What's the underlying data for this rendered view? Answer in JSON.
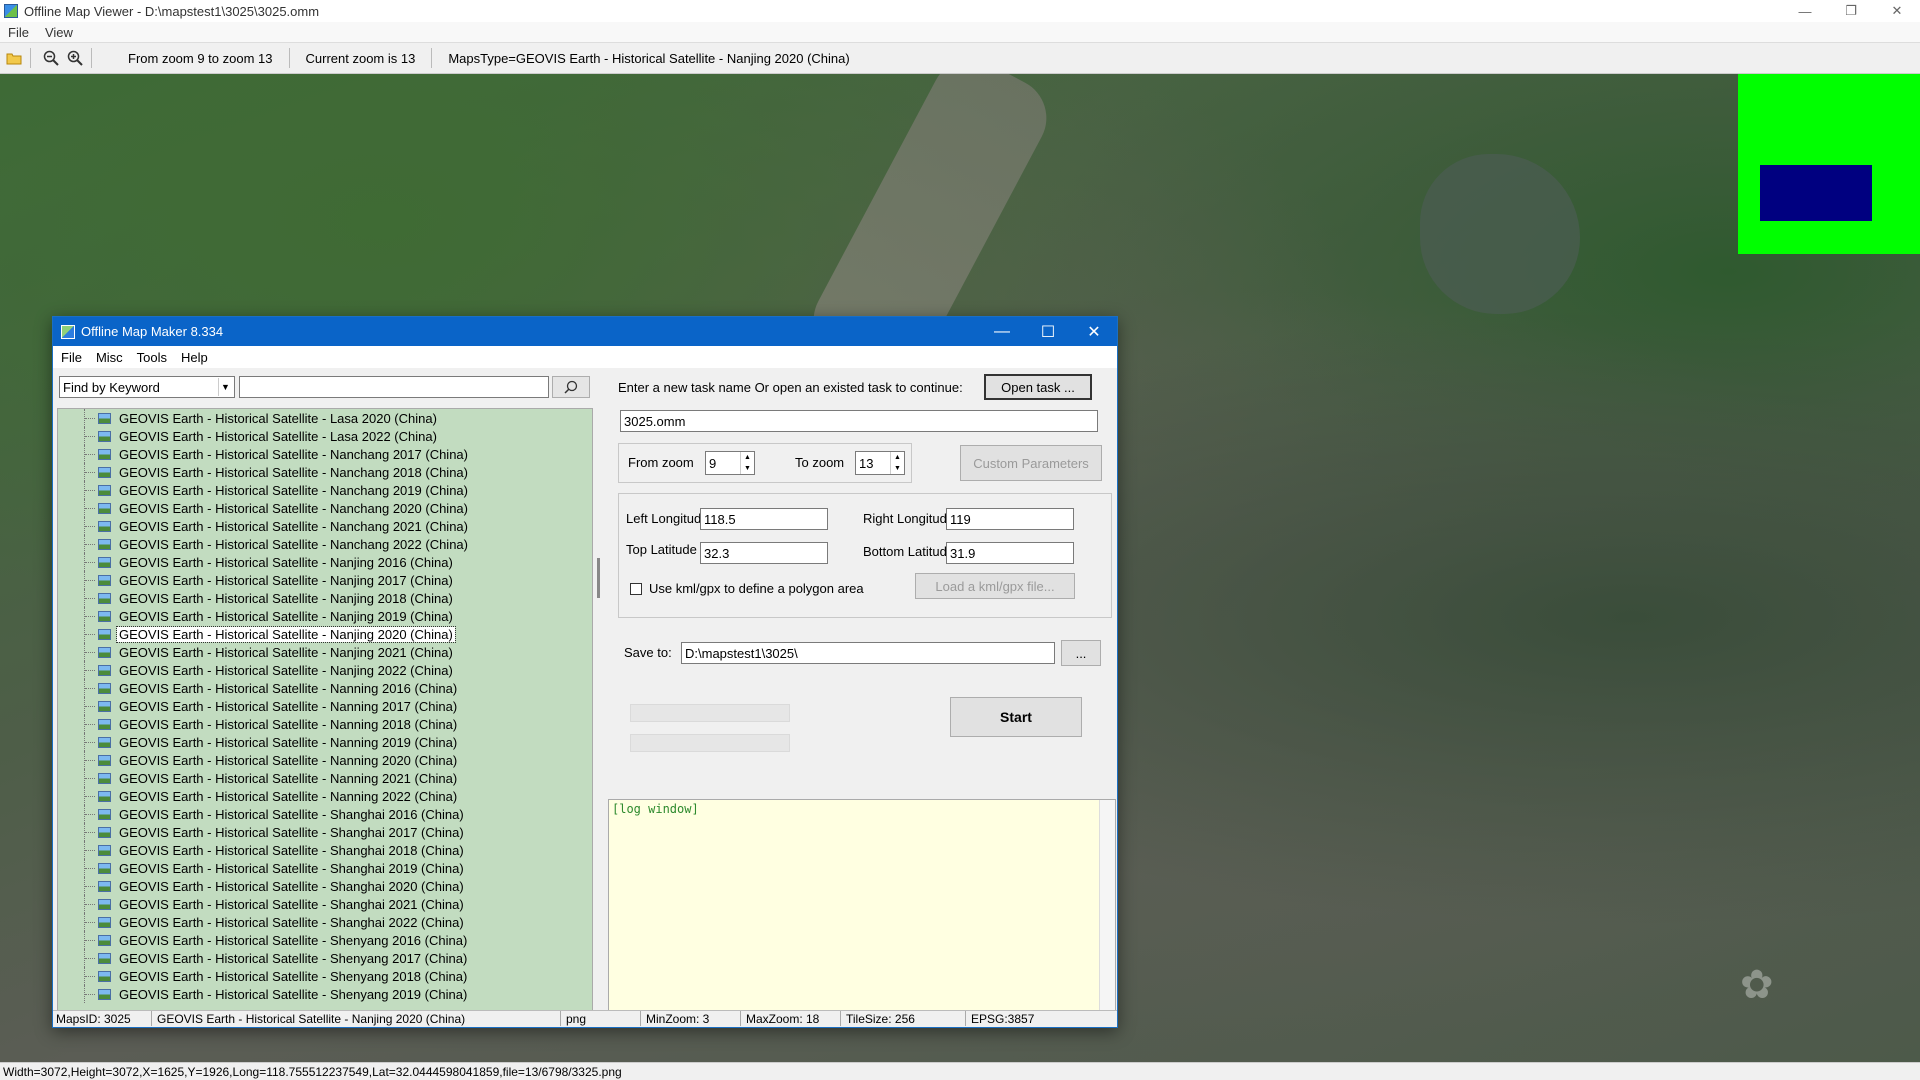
{
  "viewer": {
    "title": "Offline Map Viewer - D:\\mapstest1\\3025\\3025.omm",
    "menu": [
      "File",
      "View"
    ],
    "toolbar": {
      "zoom_range": "From zoom 9 to zoom 13",
      "current_zoom": "Current zoom is 13",
      "maps_type": "MapsType=GEOVIS Earth - Historical Satellite - Nanjing 2020 (China)"
    },
    "status": "Width=3072,Height=3072,X=1625,Y=1926,Long=118.755512237549,Lat=32.0444598041859,file=13/6798/3325.png",
    "icons": [
      "open-folder-icon",
      "zoom-out-icon",
      "zoom-in-icon"
    ],
    "overview_colors": {
      "background": "#00ff00",
      "frame": "#000080"
    }
  },
  "dialog": {
    "title": "Offline Map Maker 8.334",
    "menu": [
      "File",
      "Misc",
      "Tools",
      "Help"
    ],
    "find": {
      "selected": "Find by Keyword",
      "value": ""
    },
    "tree_items": [
      "GEOVIS Earth - Historical Satellite - Lasa 2020 (China)",
      "GEOVIS Earth - Historical Satellite - Lasa 2022 (China)",
      "GEOVIS Earth - Historical Satellite - Nanchang 2017 (China)",
      "GEOVIS Earth - Historical Satellite - Nanchang 2018 (China)",
      "GEOVIS Earth - Historical Satellite - Nanchang 2019 (China)",
      "GEOVIS Earth - Historical Satellite - Nanchang 2020 (China)",
      "GEOVIS Earth - Historical Satellite - Nanchang 2021 (China)",
      "GEOVIS Earth - Historical Satellite - Nanchang 2022 (China)",
      "GEOVIS Earth - Historical Satellite - Nanjing 2016 (China)",
      "GEOVIS Earth - Historical Satellite - Nanjing 2017 (China)",
      "GEOVIS Earth - Historical Satellite - Nanjing 2018 (China)",
      "GEOVIS Earth - Historical Satellite - Nanjing 2019 (China)",
      "GEOVIS Earth - Historical Satellite - Nanjing 2020 (China)",
      "GEOVIS Earth - Historical Satellite - Nanjing 2021 (China)",
      "GEOVIS Earth - Historical Satellite - Nanjing 2022 (China)",
      "GEOVIS Earth - Historical Satellite - Nanning 2016 (China)",
      "GEOVIS Earth - Historical Satellite - Nanning 2017 (China)",
      "GEOVIS Earth - Historical Satellite - Nanning 2018 (China)",
      "GEOVIS Earth - Historical Satellite - Nanning 2019 (China)",
      "GEOVIS Earth - Historical Satellite - Nanning 2020 (China)",
      "GEOVIS Earth - Historical Satellite - Nanning 2021 (China)",
      "GEOVIS Earth - Historical Satellite - Nanning 2022 (China)",
      "GEOVIS Earth - Historical Satellite - Shanghai 2016 (China)",
      "GEOVIS Earth - Historical Satellite - Shanghai 2017 (China)",
      "GEOVIS Earth - Historical Satellite - Shanghai 2018 (China)",
      "GEOVIS Earth - Historical Satellite - Shanghai 2019 (China)",
      "GEOVIS Earth - Historical Satellite - Shanghai 2020 (China)",
      "GEOVIS Earth - Historical Satellite - Shanghai 2021 (China)",
      "GEOVIS Earth - Historical Satellite - Shanghai 2022 (China)",
      "GEOVIS Earth - Historical Satellite - Shenyang 2016 (China)",
      "GEOVIS Earth - Historical Satellite - Shenyang 2017 (China)",
      "GEOVIS Earth - Historical Satellite - Shenyang 2018 (China)",
      "GEOVIS Earth - Historical Satellite - Shenyang 2019 (China)"
    ],
    "selected_index": 12,
    "task": {
      "prompt": "Enter a new task name Or open an existed task to continue:",
      "open_button": "Open task ...",
      "name": "3025.omm"
    },
    "zoom": {
      "from_label": "From zoom",
      "from_value": "9",
      "to_label": "To zoom",
      "to_value": "13",
      "custom_button": "Custom Parameters"
    },
    "bounds": {
      "left_label": "Left Longitude",
      "left_value": "118.5",
      "right_label": "Right Longitude",
      "right_value": "119",
      "top_label": "Top Latitude",
      "top_value": "32.3",
      "bottom_label": "Bottom Latitude",
      "bottom_value": "31.9",
      "kml_label": "Use kml/gpx to define a polygon area",
      "kml_checked": false,
      "kml_button": "Load a kml/gpx file..."
    },
    "save": {
      "label": "Save to:",
      "path": "D:\\mapstest1\\3025\\",
      "browse": "..."
    },
    "start_button": "Start",
    "log": "[log window]",
    "status": {
      "mapsid": "MapsID: 3025",
      "name": "GEOVIS Earth - Historical Satellite - Nanjing 2020 (China)",
      "format": "png",
      "minzoom": "MinZoom: 3",
      "maxzoom": "MaxZoom: 18",
      "tilesize": "TileSize: 256",
      "epsg": "EPSG:3857"
    }
  }
}
